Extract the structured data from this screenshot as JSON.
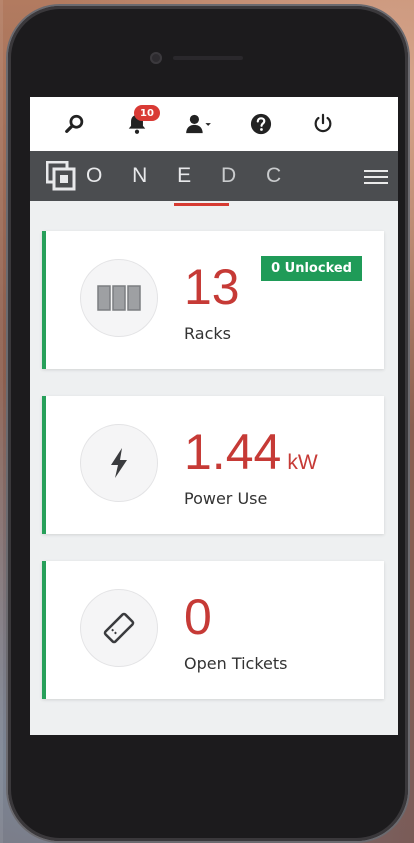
{
  "app": {
    "brand_one": "O N E",
    "brand_dc": "D C"
  },
  "topbar": {
    "notifications_count": "10"
  },
  "cards": [
    {
      "value": "13",
      "unit": "",
      "label": "Racks",
      "badge": "0 Unlocked",
      "icon": "rack-icon"
    },
    {
      "value": "1.44",
      "unit": "kW",
      "label": "Power Use",
      "icon": "bolt-icon"
    },
    {
      "value": "0",
      "unit": "",
      "label": "Open Tickets",
      "icon": "ticket-icon"
    }
  ],
  "colors": {
    "accent_red": "#c63a36",
    "status_green": "#27a05a",
    "brand_bar": "#4b4d50"
  }
}
